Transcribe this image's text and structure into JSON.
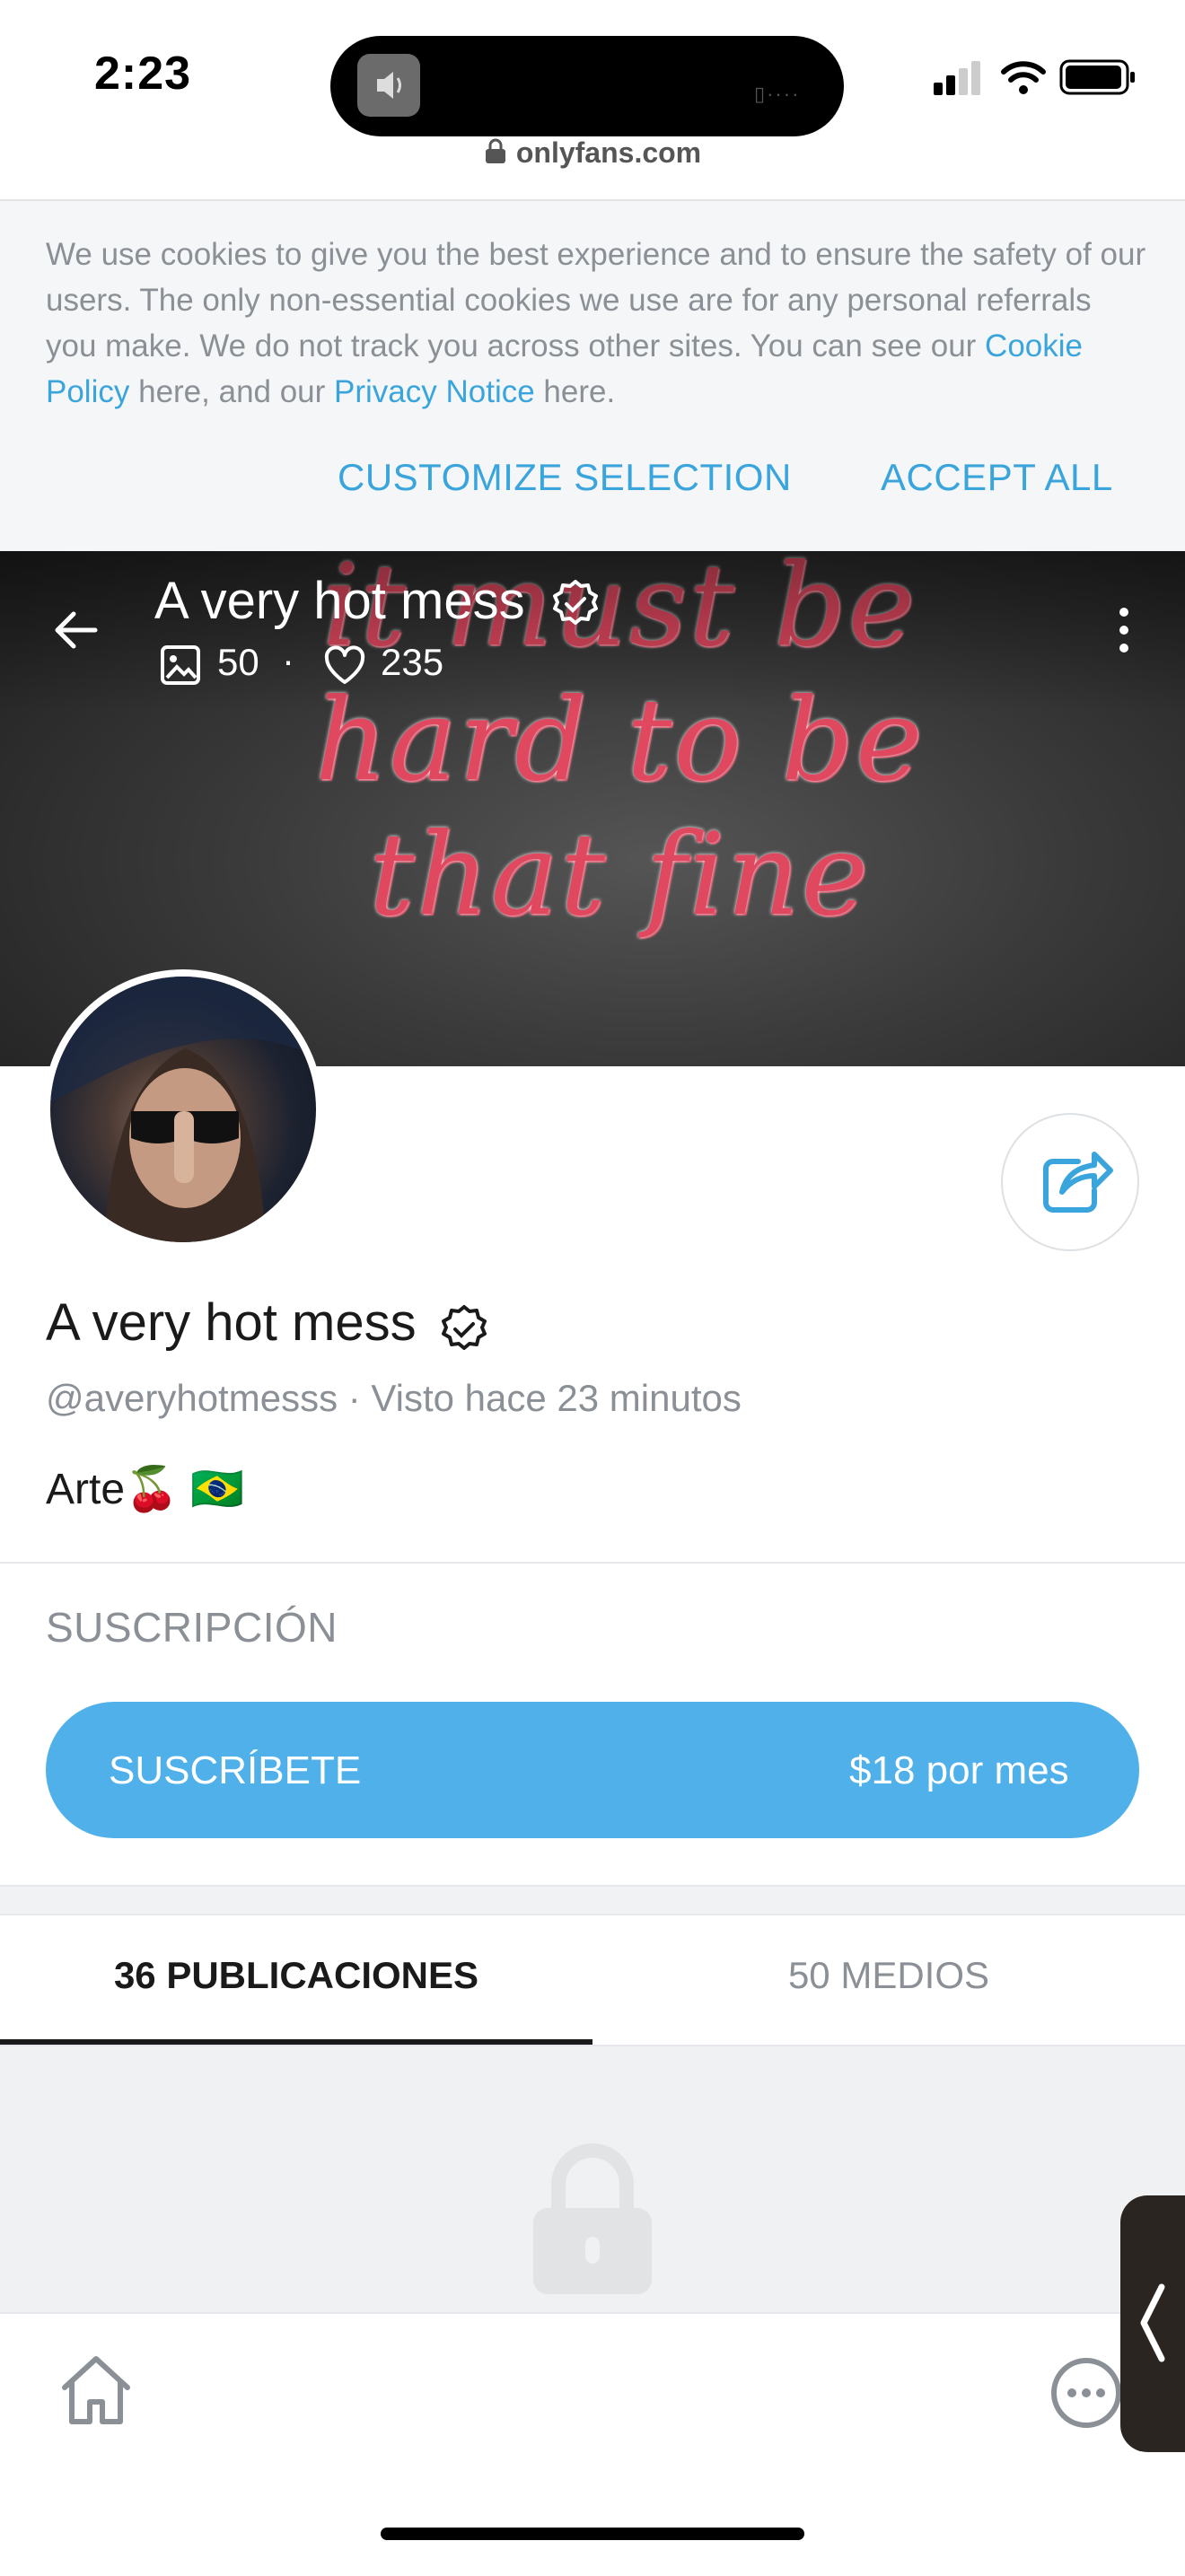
{
  "status_bar": {
    "time": "2:23",
    "url": "onlyfans.com"
  },
  "cookie_banner": {
    "text_before": "We use cookies to give you the best experience and to ensure the safety of our users. The only non-essential cookies we use are for any personal referrals you make. We do not track you across other sites. You can see our ",
    "cookie_link": "Cookie Policy",
    "text_middle": " here, and our ",
    "privacy_link": "Privacy Notice",
    "text_after": " here.",
    "customize_label": "CUSTOMIZE SELECTION",
    "accept_label": "ACCEPT ALL"
  },
  "header": {
    "name": "A very hot mess",
    "photos_count": "50",
    "likes_count": "235",
    "cover_text": "it must be hard to be that fine"
  },
  "profile": {
    "name": "A very hot mess",
    "handle_line": "@averyhotmesss  ·  Visto  hace 23 minutos",
    "bio": "Arte🍒 🇧🇷"
  },
  "subscription": {
    "heading": "SUSCRIPCIÓN",
    "button_label": "SUSCRÍBETE",
    "price": "$18 por mes"
  },
  "tabs": [
    {
      "label": "36 PUBLICACIONES",
      "active": true
    },
    {
      "label": "50 MEDIOS",
      "active": false
    }
  ],
  "colors": {
    "accent": "#3aa5dc",
    "subscribe_button": "#4fb0ea",
    "muted_text": "#8a9096",
    "cover_lettering": "#e0485f"
  },
  "icons": [
    "back-arrow-icon",
    "verified-badge-icon",
    "photo-icon",
    "heart-icon",
    "more-vertical-icon",
    "share-icon",
    "lock-icon",
    "home-icon",
    "chat-more-icon",
    "chevron-left-icon"
  ]
}
